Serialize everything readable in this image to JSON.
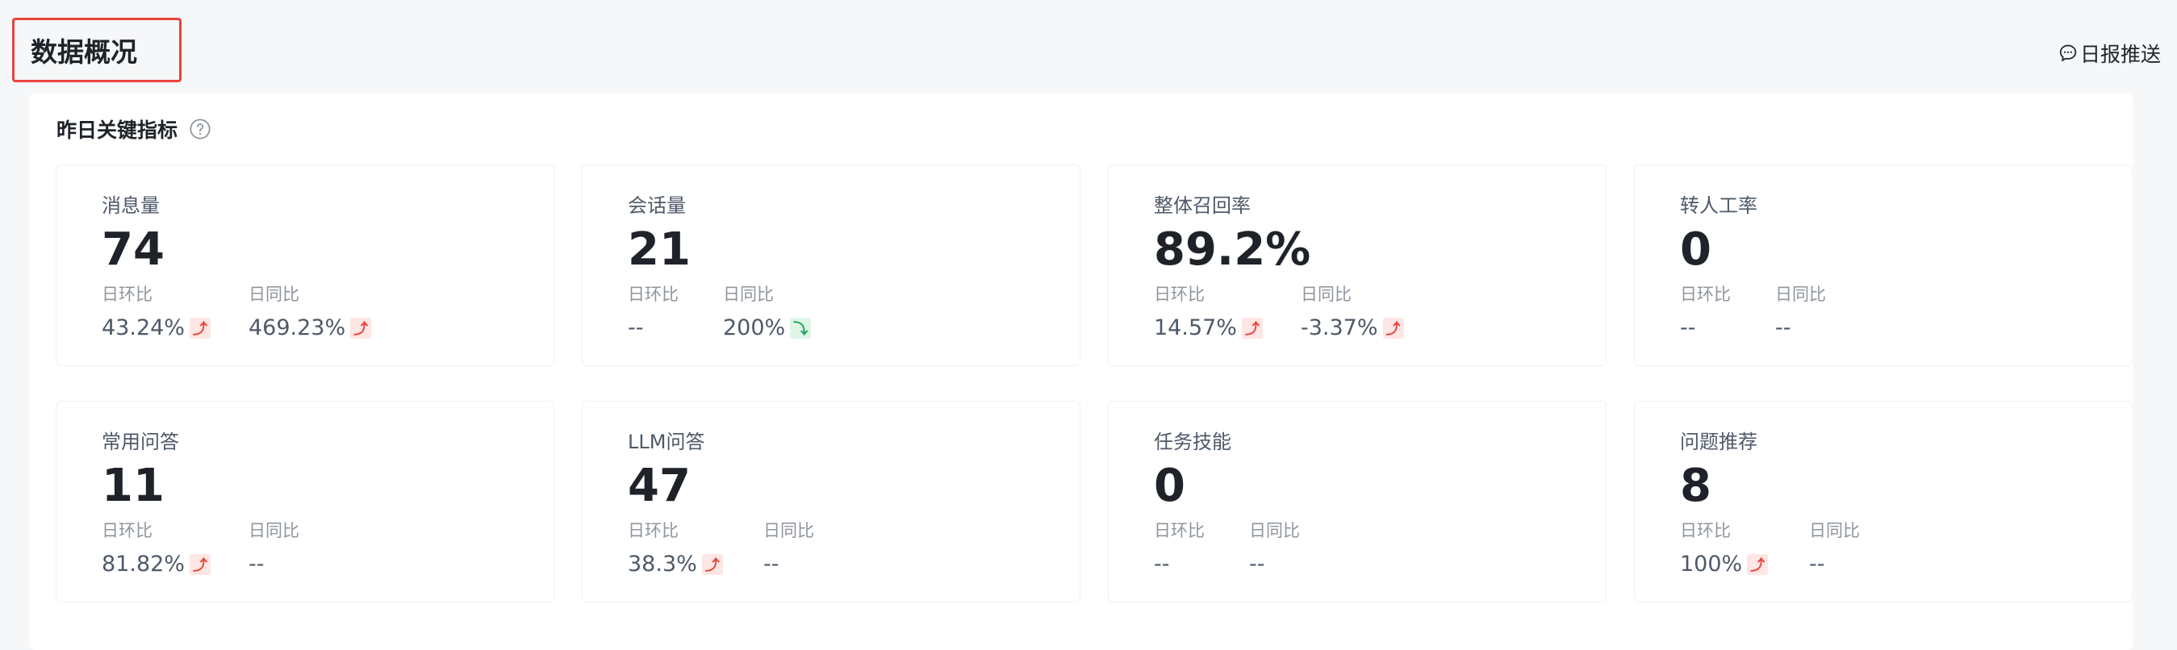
{
  "header": {
    "title": "数据概况",
    "report_push_label": "日报推送"
  },
  "section": {
    "title": "昨日关键指标"
  },
  "labels": {
    "day_over_day": "日环比",
    "week_over_week": "日同比"
  },
  "colors": {
    "up": "#e8433c",
    "down": "#1fa35b",
    "title_border": "#e8433c"
  },
  "metrics": [
    {
      "label": "消息量",
      "value": "74",
      "dod": "43.24%",
      "dod_trend": "up",
      "yoy": "469.23%",
      "yoy_trend": "up"
    },
    {
      "label": "会话量",
      "value": "21",
      "dod": "--",
      "dod_trend": "",
      "yoy": "200%",
      "yoy_trend": "down"
    },
    {
      "label": "整体召回率",
      "value": "89.2%",
      "dod": "14.57%",
      "dod_trend": "up",
      "yoy": "-3.37%",
      "yoy_trend": "up"
    },
    {
      "label": "转人工率",
      "value": "0",
      "dod": "--",
      "dod_trend": "",
      "yoy": "--",
      "yoy_trend": ""
    },
    {
      "label": "常用问答",
      "value": "11",
      "dod": "81.82%",
      "dod_trend": "up",
      "yoy": "--",
      "yoy_trend": ""
    },
    {
      "label": "LLM问答",
      "value": "47",
      "dod": "38.3%",
      "dod_trend": "up",
      "yoy": "--",
      "yoy_trend": ""
    },
    {
      "label": "任务技能",
      "value": "0",
      "dod": "--",
      "dod_trend": "",
      "yoy": "--",
      "yoy_trend": ""
    },
    {
      "label": "问题推荐",
      "value": "8",
      "dod": "100%",
      "dod_trend": "up",
      "yoy": "--",
      "yoy_trend": ""
    }
  ]
}
